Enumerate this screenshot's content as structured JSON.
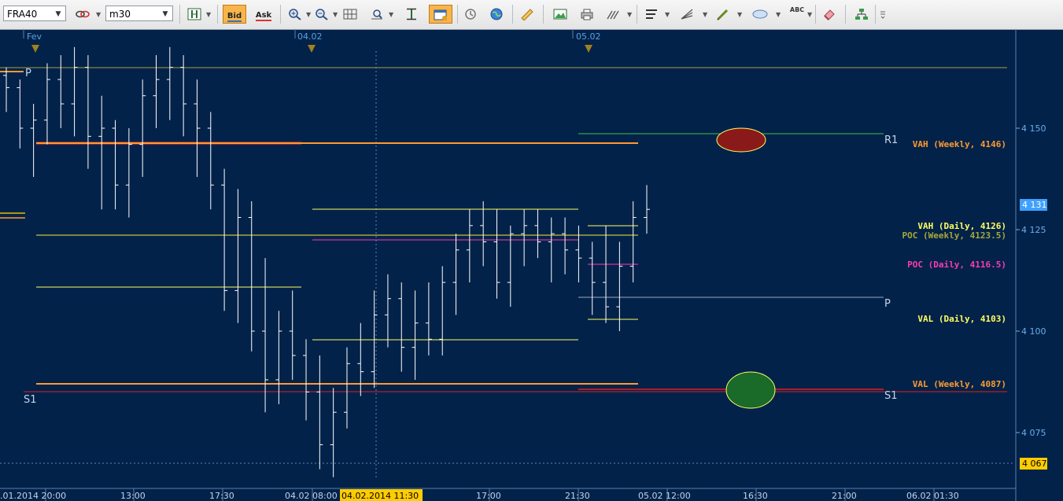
{
  "toolbar": {
    "symbol": "FRA40",
    "timeframe": "m30",
    "bid_label": "Bid",
    "ask_label": "Ask",
    "abc_label": "ABC"
  },
  "chart_data": {
    "type": "candlestick",
    "title": "",
    "date_markers": [
      "Fev",
      "04.02",
      "05.02"
    ],
    "y_ticks": [
      "4 150",
      "4 125",
      "4 100",
      "4 075"
    ],
    "x_ticks": [
      ".01.2014 20:00",
      "13:00",
      "17:30",
      "04.02 08:00",
      "04.02.2014 11:30",
      "17:00",
      "21:30",
      "05.02 12:00",
      "16:30",
      "21:00",
      "06.02 01:30"
    ],
    "cursor_time": "04.02.2014 11:30",
    "price_tags": [
      {
        "text": "4 131",
        "value": 4131,
        "color": "#3fa0ff"
      },
      {
        "text": "4 067",
        "value": 4067,
        "color": "#ffcc00"
      }
    ],
    "levels": [
      {
        "text": "VAH (Weekly, 4146)",
        "value": 4146,
        "color": "#ff9a30"
      },
      {
        "text": "VAH (Daily, 4126)",
        "value": 4126,
        "color": "#ffff60"
      },
      {
        "text": "POC (Weekly, 4123.5)",
        "value": 4123.5,
        "color": "#a8a838"
      },
      {
        "text": "POC (Daily, 4116.5)",
        "value": 4116.5,
        "color": "#ff3bb0"
      },
      {
        "text": "VAL (Daily, 4103)",
        "value": 4103,
        "color": "#ffff60"
      },
      {
        "text": "VAL (Weekly, 4087)",
        "value": 4087,
        "color": "#ff9a30"
      }
    ],
    "pivots": [
      {
        "text": "P",
        "value": 4166
      },
      {
        "text": "R1",
        "value": 4147
      },
      {
        "text": "P",
        "value": 4109
      },
      {
        "text": "S1",
        "value": 4084
      },
      {
        "text": "S1",
        "value": 4084
      }
    ],
    "ohlc": [
      [
        4163,
        4165,
        4154,
        4160
      ],
      [
        4160,
        4162,
        4145,
        4150
      ],
      [
        4150,
        4156,
        4138,
        4152
      ],
      [
        4152,
        4166,
        4146,
        4162
      ],
      [
        4162,
        4168,
        4150,
        4156
      ],
      [
        4156,
        4170,
        4148,
        4165
      ],
      [
        4165,
        4168,
        4140,
        4148
      ],
      [
        4148,
        4158,
        4130,
        4150
      ],
      [
        4150,
        4152,
        4130,
        4136
      ],
      [
        4136,
        4150,
        4128,
        4146
      ],
      [
        4146,
        4162,
        4138,
        4158
      ],
      [
        4158,
        4168,
        4150,
        4162
      ],
      [
        4162,
        4170,
        4152,
        4165
      ],
      [
        4165,
        4168,
        4148,
        4156
      ],
      [
        4156,
        4162,
        4138,
        4150
      ],
      [
        4150,
        4154,
        4130,
        4136
      ],
      [
        4136,
        4140,
        4105,
        4110
      ],
      [
        4110,
        4135,
        4102,
        4128
      ],
      [
        4128,
        4132,
        4095,
        4100
      ],
      [
        4100,
        4118,
        4080,
        4088
      ],
      [
        4088,
        4105,
        4082,
        4100
      ],
      [
        4100,
        4110,
        4088,
        4094
      ],
      [
        4094,
        4098,
        4078,
        4085
      ],
      [
        4085,
        4094,
        4066,
        4072
      ],
      [
        4072,
        4086,
        4064,
        4080
      ],
      [
        4080,
        4096,
        4076,
        4092
      ],
      [
        4092,
        4102,
        4084,
        4090
      ],
      [
        4090,
        4110,
        4086,
        4104
      ],
      [
        4104,
        4114,
        4096,
        4108
      ],
      [
        4108,
        4112,
        4090,
        4096
      ],
      [
        4096,
        4110,
        4088,
        4102
      ],
      [
        4102,
        4112,
        4094,
        4098
      ],
      [
        4098,
        4116,
        4094,
        4112
      ],
      [
        4112,
        4124,
        4104,
        4120
      ],
      [
        4120,
        4130,
        4112,
        4126
      ],
      [
        4126,
        4132,
        4116,
        4122
      ],
      [
        4122,
        4130,
        4108,
        4112
      ],
      [
        4112,
        4126,
        4106,
        4124
      ],
      [
        4124,
        4130,
        4116,
        4126
      ],
      [
        4126,
        4130,
        4118,
        4122
      ],
      [
        4122,
        4128,
        4112,
        4124
      ],
      [
        4124,
        4128,
        4114,
        4120
      ],
      [
        4120,
        4126,
        4112,
        4118
      ],
      [
        4118,
        4122,
        4104,
        4112
      ],
      [
        4112,
        4126,
        4102,
        4106
      ],
      [
        4106,
        4122,
        4100,
        4116
      ],
      [
        4116,
        4132,
        4112,
        4128
      ],
      [
        4128,
        4136,
        4124,
        4130
      ]
    ]
  }
}
